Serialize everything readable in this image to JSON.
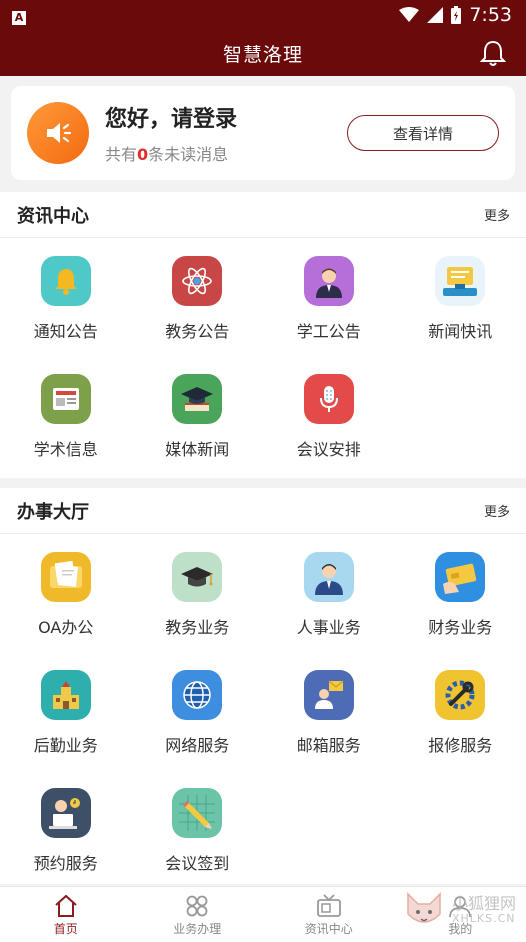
{
  "status_bar": {
    "time": "7:53"
  },
  "header": {
    "title": "智慧洛理"
  },
  "login_card": {
    "title": "您好，请登录",
    "unread_prefix": "共有",
    "unread_count": "0",
    "unread_suffix": "条未读消息",
    "detail_button": "查看详情"
  },
  "news_section": {
    "title": "资讯中心",
    "more": "更多",
    "items": [
      {
        "label": "通知公告",
        "icon": "bell-icon",
        "color": "#4fc8c8"
      },
      {
        "label": "教务公告",
        "icon": "atom-icon",
        "color": "#c94646"
      },
      {
        "label": "学工公告",
        "icon": "person-icon",
        "color": "#b66fd8"
      },
      {
        "label": "新闻快讯",
        "icon": "news-desk-icon",
        "color": "#3aa0d8"
      },
      {
        "label": "学术信息",
        "icon": "newspaper-icon",
        "color": "#7fa04a"
      },
      {
        "label": "媒体新闻",
        "icon": "graduation-cap-icon",
        "color": "#4aa55a"
      },
      {
        "label": "会议安排",
        "icon": "microphone-icon",
        "color": "#e34b4b"
      }
    ]
  },
  "service_section": {
    "title": "办事大厅",
    "more": "更多",
    "items": [
      {
        "label": "OA办公",
        "icon": "documents-icon",
        "color": "#f0b92a"
      },
      {
        "label": "教务业务",
        "icon": "mortarboard-icon",
        "color": "#bfe0c8"
      },
      {
        "label": "人事业务",
        "icon": "user-icon",
        "color": "#a8d8f0"
      },
      {
        "label": "财务业务",
        "icon": "card-icon",
        "color": "#2f8fe0"
      },
      {
        "label": "后勤业务",
        "icon": "building-icon",
        "color": "#2faeae"
      },
      {
        "label": "网络服务",
        "icon": "globe-icon",
        "color": "#3e8ee0"
      },
      {
        "label": "邮箱服务",
        "icon": "mail-user-icon",
        "color": "#4e6cb5"
      },
      {
        "label": "报修服务",
        "icon": "wrench-icon",
        "color": "#f0c330"
      },
      {
        "label": "预约服务",
        "icon": "laptop-user-icon",
        "color": "#3e5068"
      },
      {
        "label": "会议签到",
        "icon": "pencil-icon",
        "color": "#6cc4a8"
      }
    ]
  },
  "tab_bar": [
    {
      "label": "首页",
      "icon": "home-icon",
      "active": true
    },
    {
      "label": "业务办理",
      "icon": "grid-icon",
      "active": false
    },
    {
      "label": "资讯中心",
      "icon": "tv-icon",
      "active": false
    },
    {
      "label": "我的",
      "icon": "profile-icon",
      "active": false
    }
  ],
  "watermark": {
    "line1": "小狐狸网",
    "line2": "XHLKS.CN"
  }
}
